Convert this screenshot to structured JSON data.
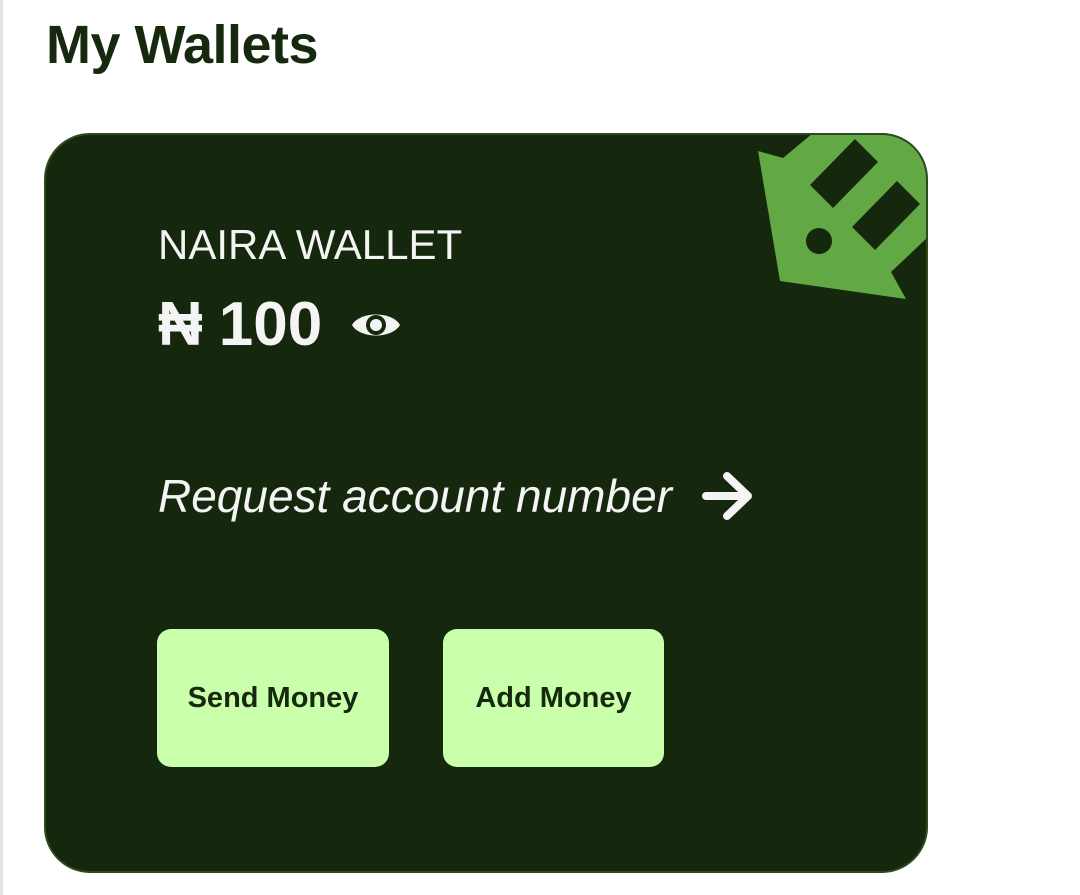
{
  "page": {
    "title": "My Wallets"
  },
  "wallet": {
    "name": "NAIRA WALLET",
    "currency_symbol": "₦",
    "balance": "100",
    "request_label": "Request account number",
    "send_label": "Send Money",
    "add_label": "Add Money"
  },
  "icons": {
    "logo": "wallet-brand-logo",
    "visibility": "eye-icon",
    "arrow": "arrow-right-icon"
  },
  "colors": {
    "card_background": "#15270c",
    "title_text": "#16290e",
    "logo_green": "#62a845",
    "button_background": "#caffac",
    "card_text": "#f4f4f4"
  }
}
